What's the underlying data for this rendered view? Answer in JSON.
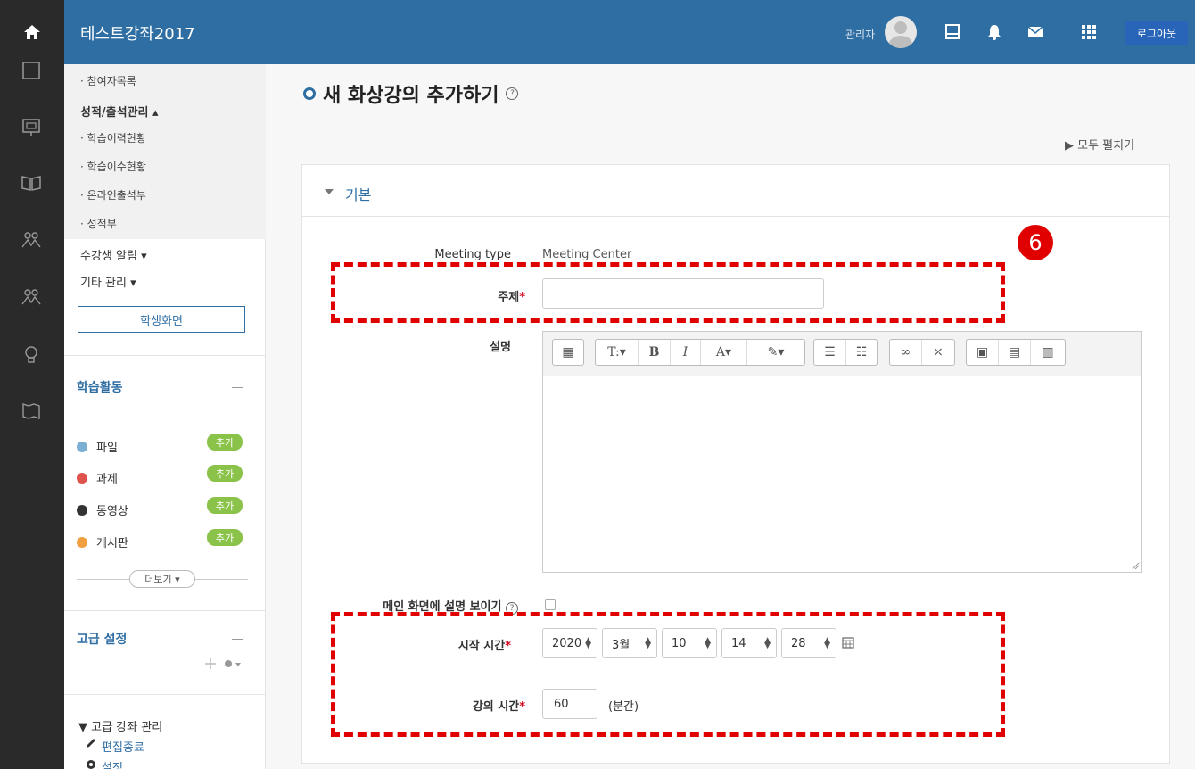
{
  "header": {
    "site_title": "테스트강좌2017",
    "admin_label": "관리자",
    "logout_label": "로그아웃"
  },
  "sidebar": {
    "menu": [
      {
        "label": "· 참여자목록"
      },
      {
        "label": "성적/출석관리 ▴"
      },
      {
        "label": "· 학습이력현황"
      },
      {
        "label": "· 학습이수현황"
      },
      {
        "label": "· 온라인출석부"
      },
      {
        "label": "· 성적부"
      },
      {
        "label": "수강생 알림 ▾"
      },
      {
        "label": "기타 관리 ▾"
      }
    ],
    "student_view_label": "학생화면",
    "activities_title": "학습활동",
    "activities": [
      {
        "label": "파일",
        "color": "#7bafd4"
      },
      {
        "label": "과제",
        "color": "#e0524c"
      },
      {
        "label": "동영상",
        "color": "#333333"
      },
      {
        "label": "게시판",
        "color": "#f0a040"
      }
    ],
    "add_label": "추가",
    "more_label": "더보기 ▾",
    "advanced_title": "고급 설정",
    "advanced_manage_label": "▼ 고급 강좌 관리",
    "edit_end_label": "편집종료",
    "settings_label": "설정"
  },
  "main": {
    "page_title": "새 화상강의 추가하기",
    "help_symbol": "?",
    "expand_all_label": "▶ 모두 펼치기",
    "section_title": "기본",
    "form": {
      "meeting_type_label": "Meeting type",
      "meeting_type_value": "Meeting Center",
      "subject_label": "주제",
      "description_label": "설명",
      "show_desc_label": "메인 화면에 설명 보이기",
      "start_time_label": "시작 시간",
      "duration_label": "강의 시간",
      "required_mark": "*",
      "start_year": "2020",
      "start_month": "3월",
      "start_day": "10",
      "start_hour": "14",
      "start_minute": "28",
      "duration_value": "60",
      "duration_unit": "(분간)"
    },
    "editor_toolbar": [
      "T:▾",
      "B",
      "I",
      "A▾",
      "✎▾"
    ]
  },
  "annotation": {
    "step_number": "6",
    "color": "#e00000"
  },
  "colors": {
    "topbar": "#2f6ea3",
    "rail": "#2a2a2a",
    "accent": "#2f6ea3",
    "badge_green": "#8bc34a"
  }
}
